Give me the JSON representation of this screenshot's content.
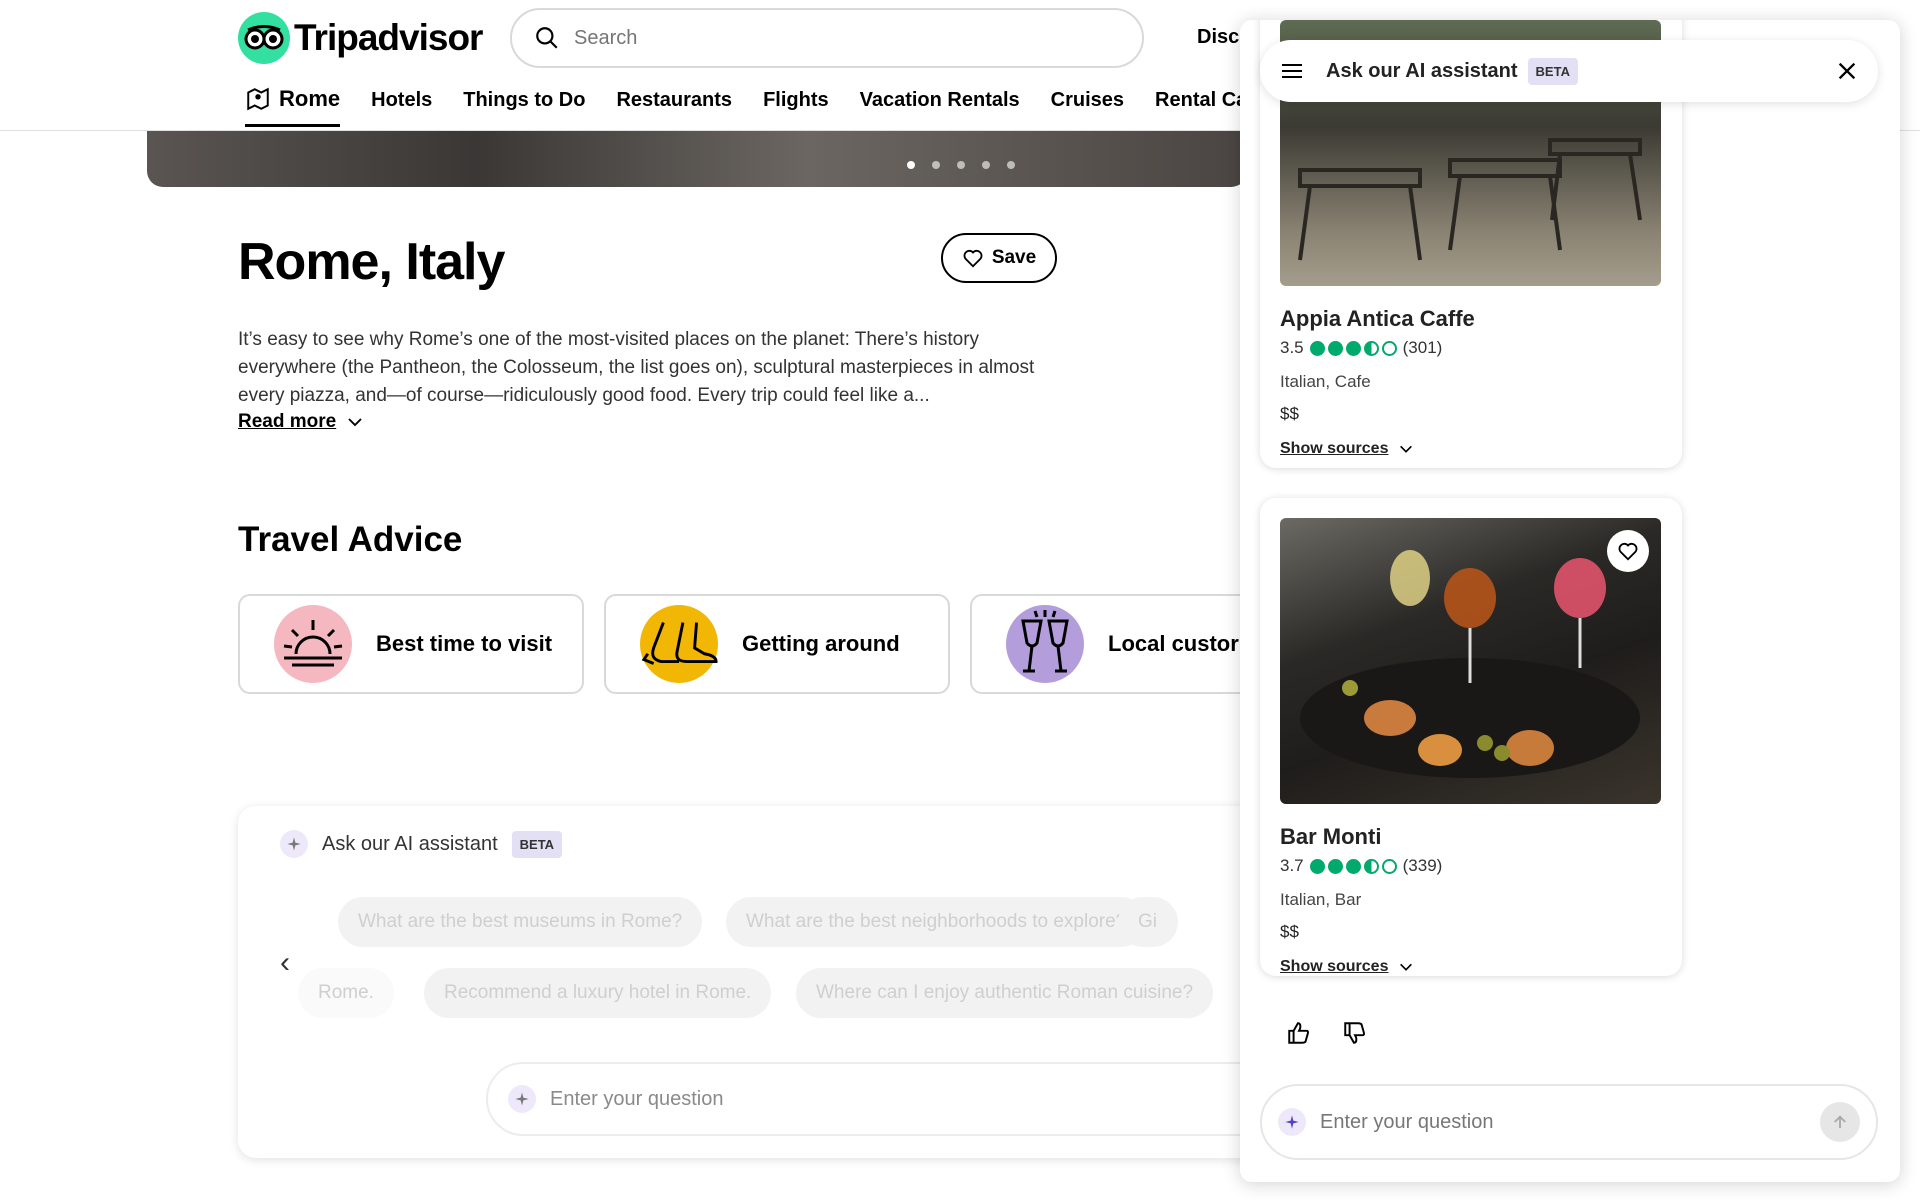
{
  "header": {
    "logo_text": "Tripadvisor",
    "search_placeholder": "Search",
    "discover_partial": "Disco",
    "nav": [
      {
        "label": "Rome",
        "icon": "map-pin-icon"
      },
      {
        "label": "Hotels"
      },
      {
        "label": "Things to Do"
      },
      {
        "label": "Restaurants"
      },
      {
        "label": "Flights"
      },
      {
        "label": "Vacation Rentals"
      },
      {
        "label": "Cruises"
      },
      {
        "label": "Rental Cars"
      }
    ]
  },
  "page": {
    "title": "Rome, Italy",
    "save_label": "Save",
    "description": "It’s easy to see why Rome’s one of the most-visited places on the planet: There’s history everywhere (the Pantheon, the Colosseum, the list goes on), sculptural masterpieces in almost every piazza, and—of course—ridiculously good food. Every trip could feel like a...",
    "read_more": "Read more",
    "travel_advice_heading": "Travel Advice",
    "advice_cards": [
      {
        "label": "Best time to visit",
        "icon": "sunrise-icon",
        "color": "#f6b8c0"
      },
      {
        "label": "Getting around",
        "icon": "shoes-icon",
        "color": "#f2b705"
      },
      {
        "label": "Local custor",
        "icon": "toast-glasses-icon",
        "color": "#b39ddb"
      }
    ]
  },
  "ai_box": {
    "label": "Ask our AI assistant",
    "beta": "BETA",
    "chips_row1": [
      "What are the best museums in Rome?",
      "What are the best neighborhoods to explore?",
      "Gi"
    ],
    "chips_row2": [
      "Rome.",
      "Recommend a luxury hotel in Rome.",
      "Where can I enjoy authentic Roman cuisine?"
    ],
    "input_placeholder": "Enter your question"
  },
  "panel": {
    "title": "Ask our AI assistant",
    "beta": "BETA",
    "results": [
      {
        "name": "Appia Antica Caffe",
        "rating": "3.5",
        "rating_value": 3.5,
        "reviews": "(301)",
        "cuisine": "Italian, Cafe",
        "price": "$$",
        "sources": "Show sources"
      },
      {
        "name": "Bar Monti",
        "rating": "3.7",
        "rating_value": 3.5,
        "reviews": "(339)",
        "cuisine": "Italian, Bar",
        "price": "$$",
        "sources": "Show sources"
      }
    ],
    "input_placeholder": "Enter your question"
  }
}
